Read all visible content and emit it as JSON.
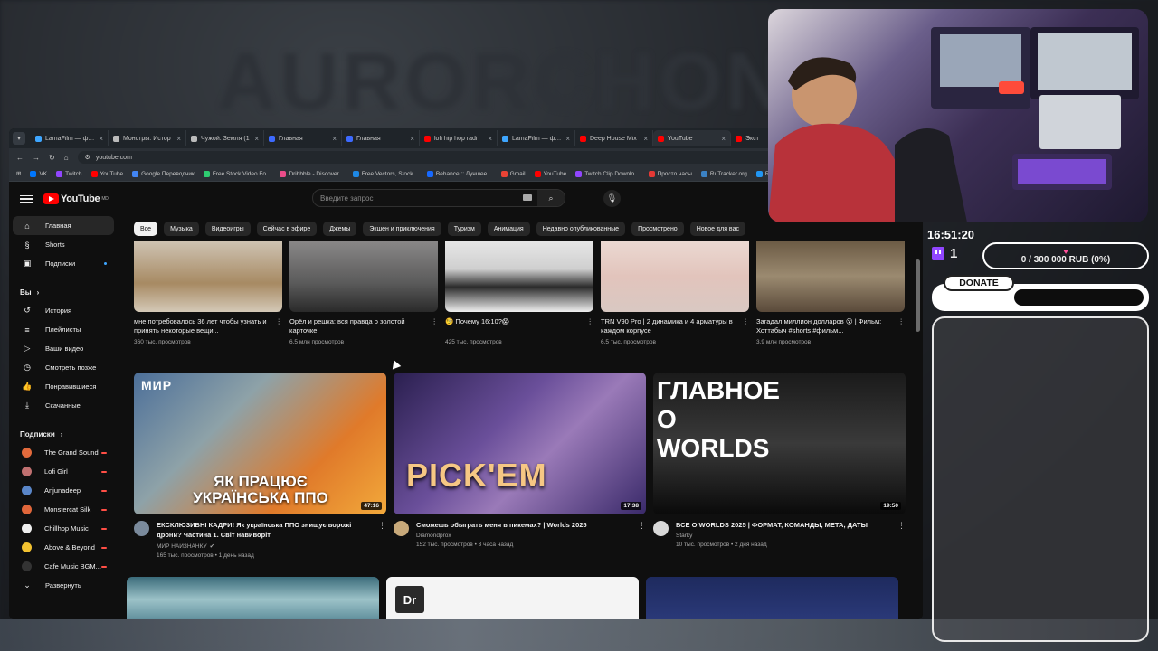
{
  "browser": {
    "tabs": [
      {
        "title": "LamaFilm — фил",
        "color": "#3ea6ff"
      },
      {
        "title": "Монстры: Истор",
        "color": "#bbbbbb"
      },
      {
        "title": "Чужой: Земля (1",
        "color": "#bbbbbb"
      },
      {
        "title": "Главная",
        "color": "#3d6aff"
      },
      {
        "title": "Главная",
        "color": "#3d6aff"
      },
      {
        "title": "lofi hip hop radi",
        "color": "#ff0000"
      },
      {
        "title": "LamaFilm — фил",
        "color": "#3ea6ff"
      },
      {
        "title": "Deep House Mix",
        "color": "#ff0000"
      },
      {
        "title": "YouTube",
        "color": "#ff0000",
        "active": true
      },
      {
        "title": "Экст",
        "color": "#ff0000"
      }
    ],
    "url": "youtube.com",
    "bookmarks": [
      {
        "label": "VK",
        "color": "#0077ff"
      },
      {
        "label": "Twitch",
        "color": "#9146ff"
      },
      {
        "label": "YouTube",
        "color": "#ff0000"
      },
      {
        "label": "Google Переводчик",
        "color": "#4285f4"
      },
      {
        "label": "Free Stock Video Fo...",
        "color": "#2ecc71"
      },
      {
        "label": "Dribbble - Discover...",
        "color": "#ea4c89"
      },
      {
        "label": "Free Vectors, Stock...",
        "color": "#1e88e5"
      },
      {
        "label": "Behance :: Лучшее...",
        "color": "#1769ff"
      },
      {
        "label": "Gmail",
        "color": "#ea4335"
      },
      {
        "label": "YouTube",
        "color": "#ff0000"
      },
      {
        "label": "Twitch Clip Downlo...",
        "color": "#9146ff"
      },
      {
        "label": "Просто часы",
        "color": "#e53935"
      },
      {
        "label": "RuTracker.org",
        "color": "#3b82c4"
      },
      {
        "label": "Raade",
        "color": "#2196f3"
      }
    ]
  },
  "youtube": {
    "logo_text": "YouTube",
    "logo_region": "MD",
    "search_placeholder": "Введите запрос",
    "sidebar": {
      "main": [
        {
          "label": "Главная",
          "icon": "home-icon",
          "glyph": "⌂",
          "active": true
        },
        {
          "label": "Shorts",
          "icon": "shorts-icon",
          "glyph": "§"
        },
        {
          "label": "Подписки",
          "icon": "subscriptions-icon",
          "glyph": "▣",
          "dot": true
        }
      ],
      "you_header": "Вы",
      "you": [
        {
          "label": "История",
          "icon": "history-icon",
          "glyph": "↺"
        },
        {
          "label": "Плейлисты",
          "icon": "playlists-icon",
          "glyph": "≡"
        },
        {
          "label": "Ваши видео",
          "icon": "your-videos-icon",
          "glyph": "▷"
        },
        {
          "label": "Смотреть позже",
          "icon": "watch-later-icon",
          "glyph": "◷"
        },
        {
          "label": "Понравившиеся",
          "icon": "liked-icon",
          "glyph": "👍"
        },
        {
          "label": "Скачанные",
          "icon": "downloads-icon",
          "glyph": "⤓"
        }
      ],
      "subs_header": "Подписки",
      "subs": [
        {
          "label": "The Grand Sound",
          "color": "#e26a3c"
        },
        {
          "label": "Lofi Girl",
          "color": "#c07070"
        },
        {
          "label": "Anjunadeep",
          "color": "#5a86c8"
        },
        {
          "label": "Monstercat Silk",
          "color": "#e0663a"
        },
        {
          "label": "Chillhop Music",
          "color": "#eeeeee"
        },
        {
          "label": "Above & Beyond",
          "color": "#f2c230"
        },
        {
          "label": "Cafe Music BGM...",
          "color": "#333333"
        }
      ],
      "expand_label": "Развернуть"
    },
    "chips": [
      "Все",
      "Музыка",
      "Видеоигры",
      "Сейчас в эфире",
      "Джемы",
      "Экшен и приключения",
      "Туризм",
      "Анимация",
      "Недавно опубликованные",
      "Просмотрено",
      "Новое для вас"
    ],
    "shorts": [
      {
        "title": "мне потребовалось 36 лет чтобы узнать и принять некоторые вещи...",
        "views": "360 тыс. просмотров",
        "bg": "linear-gradient(180deg,#cfc4b4 0%,#a78a63 60%,#d4c9b7 100%)"
      },
      {
        "title": "Орёл и решка: вся правда о золотой карточке",
        "views": "6,5 млн просмотров",
        "bg": "linear-gradient(180deg,#8a8888 0%,#5a5a5a 60%,#2a2a2a 100%)"
      },
      {
        "title": "🧐 Почему 16:10?😱",
        "views": "425 тыс. просмотров",
        "bg": "linear-gradient(180deg,#e7e7e7 0%,#cfcfcf 40%,#2b2b2b 65%,#f0f0f0 100%)"
      },
      {
        "title": "TRN V90 Pro | 2 динамика и 4 арматуры в каждом корпусе",
        "views": "6,5 тыс. просмотров",
        "bg": "linear-gradient(180deg,#ebd9d2 0%,#e2c4bc 50%,#d9c8c2 100%)"
      },
      {
        "title": "Загадал миллион долларов 😮 | Фильм: Хоттабыч #shorts #фильм...",
        "views": "3,9 млн просмотров",
        "bg": "linear-gradient(180deg,#6b5a44 0%,#9b8a70 50%,#5a4a3a 100%)"
      }
    ],
    "videos": [
      {
        "title": "ЕКСКЛЮЗИВНІ КАДРИ! Як українська ППО знищує ворожі дрони? Частина 1. Світ навиворіт",
        "channel": "МИР НАИЗНАНКУ",
        "verified": "✔",
        "meta": "165 тыс. просмотров • 1 день назад",
        "duration": "47:16",
        "caption": "ЯК ПРАЦЮЄ УКРАЇНСЬКА ППО",
        "logo": "МИР",
        "avatar": "#7a8a9c",
        "bg": "linear-gradient(135deg,#4c6f99 0%,#8ea2a8 35%,#e07a2a 70%,#f2a93b 100%)"
      },
      {
        "title": "Сможешь обыграть меня в пикемах? | Worlds 2025",
        "channel": "Diamondprox",
        "verified": "",
        "meta": "152 тыс. просмотров • 3 часа назад",
        "duration": "17:38",
        "caption": "PICK'EM",
        "logo": "",
        "avatar": "#c8a97a",
        "bg": "linear-gradient(135deg,#2a1f4f 0%,#6a4f9a 40%,#9a7ab8 60%,#3a2a6a 100%)"
      },
      {
        "title": "ВСЕ О WORLDS 2025 | ФОРМАТ, КОМАНДЫ, МЕТА, ДАТЫ",
        "channel": "Starky",
        "verified": "",
        "meta": "10 тыс. просмотров • 2 дня назад",
        "duration": "19:50",
        "caption": "ГЛАВНОЕ О WORLDS",
        "logo": "",
        "avatar": "#d8d8d8",
        "bg": "linear-gradient(180deg,#1a1a1a 0%,#3a3a3a 50%,#0a0a0a 100%)"
      }
    ],
    "row3": [
      {
        "bg": "linear-gradient(180deg,#3a6b7a 0%,#9cc2c8 50%,#5a8a98 100%)",
        "badge": ""
      },
      {
        "bg": "#f4f4f4",
        "badge": "Dr"
      },
      {
        "bg": "linear-gradient(180deg,#1e2a5e 0%,#2b3a7a 100%)",
        "badge": ""
      }
    ]
  },
  "stream": {
    "clock": "16:51:20",
    "followers": "1",
    "goal_text": "0 / 300 000 RUB (0%)",
    "donate_label": "DONATE",
    "bg_logo": "AURORCHON"
  }
}
